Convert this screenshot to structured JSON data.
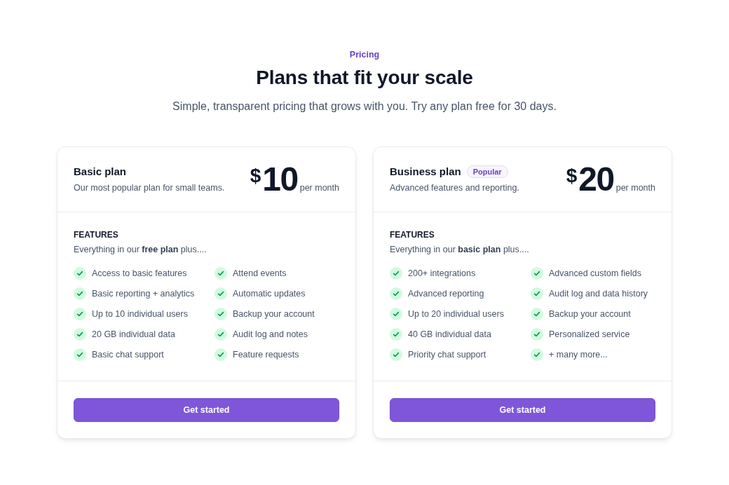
{
  "header": {
    "eyebrow": "Pricing",
    "title": "Plans that fit your scale",
    "subtitle": "Simple, transparent pricing that grows with you. Try any plan free for 30 days."
  },
  "plans": [
    {
      "name": "Basic plan",
      "description": "Our most popular plan for small teams.",
      "price": {
        "currency": "$",
        "amount": "10",
        "period": "per month"
      },
      "features_heading": "FEATURES",
      "features_intro": "Everything in our **free plan** plus....",
      "features": [
        "Access to basic features",
        "Basic reporting + analytics",
        "Up to 10 individual users",
        "20 GB individual data",
        "Basic chat support",
        "Attend events",
        "Automatic updates",
        "Backup your account",
        "Audit log and notes",
        "Feature requests"
      ],
      "button": "Get started"
    },
    {
      "name": "Business plan",
      "badge": "Popular",
      "description": "Advanced features and reporting.",
      "price": {
        "currency": "$",
        "amount": "20",
        "period": "per month"
      },
      "features_heading": "FEATURES",
      "features_intro": "Everything in our **basic plan** plus....",
      "features": [
        "200+ integrations",
        "Advanced reporting",
        "Up to 20 individual users",
        "40 GB individual data",
        "Priority chat support",
        "Advanced custom fields",
        "Audit log and data history",
        "Backup your account",
        "Personalized service",
        "+ many more..."
      ],
      "button": "Get started"
    }
  ]
}
